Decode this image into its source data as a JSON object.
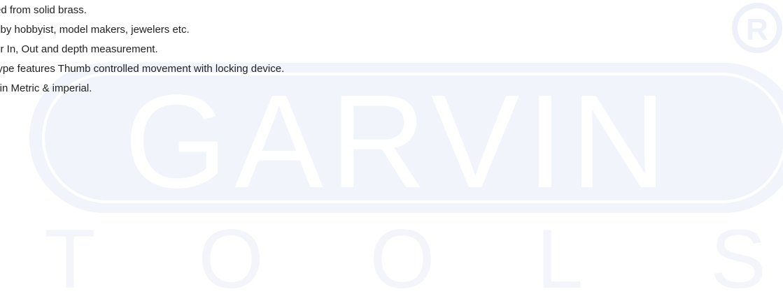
{
  "features": [
    "red from solid brass.",
    "d by hobbyist, model makers, jewelers etc.",
    " for In, Out and depth measurement.",
    "Type features Thumb controlled movement with locking device.",
    "s in Metric & imperial."
  ],
  "watermark": {
    "brand": "GARVIN",
    "registered": "R",
    "letters": [
      "T",
      "O",
      "O",
      "L",
      "S"
    ],
    "color": "#eef1fa"
  }
}
